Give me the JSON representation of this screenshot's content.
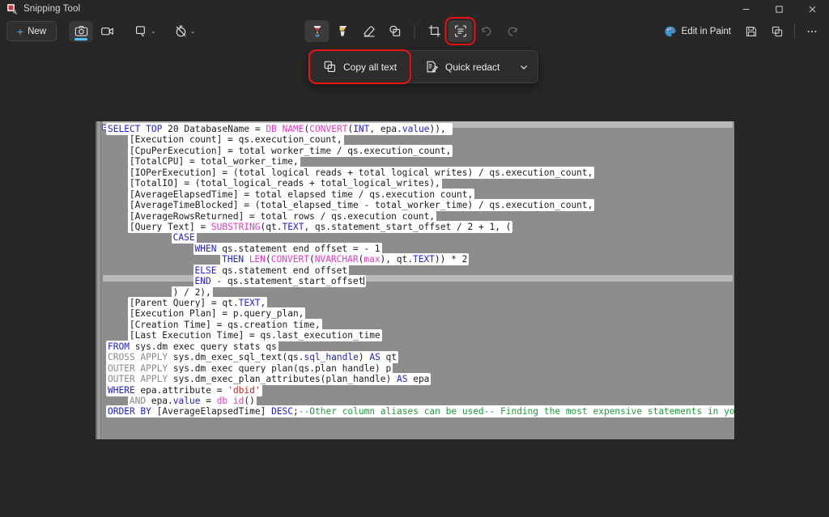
{
  "window": {
    "title": "Snipping Tool",
    "app_icon": "snipping-tool-icon",
    "controls": {
      "minimize": "—",
      "maximize": "□",
      "close": "✕"
    }
  },
  "toolbar": {
    "new_label": "New",
    "new_icon": "plus-icon",
    "mode_screenshot_icon": "camera-icon",
    "mode_video_icon": "video-camera-icon",
    "snip_mode_icon": "rectangle-snip-icon",
    "delay_icon": "timer-off-icon",
    "chevron": "⌄",
    "tools": [
      {
        "name": "ballpoint-pen",
        "label": "Ballpoint pen",
        "state": "selected",
        "color": "#e02b2b"
      },
      {
        "name": "highlighter",
        "label": "Highlighter",
        "state": "normal",
        "color": "#e8c723"
      },
      {
        "name": "eraser",
        "label": "Eraser",
        "state": "normal",
        "color": "#e2e2e2"
      },
      {
        "name": "shapes",
        "label": "Shapes",
        "state": "normal",
        "color": "#e2e2e2"
      },
      {
        "name": "crop",
        "label": "Crop",
        "state": "normal",
        "color": "#e2e2e2"
      },
      {
        "name": "text-actions",
        "label": "Text actions",
        "state": "highlighted",
        "color": "#e2e2e2"
      },
      {
        "name": "undo",
        "label": "Undo",
        "state": "disabled",
        "color": "#6d6d6d"
      },
      {
        "name": "redo",
        "label": "Redo",
        "state": "disabled",
        "color": "#6d6d6d"
      }
    ],
    "edit_in_paint_label": "Edit in Paint",
    "edit_in_paint_icon": "paint-palette-icon",
    "save_icon": "save-disk-icon",
    "copy_icon": "copy-icon",
    "more_icon": "ellipsis-icon"
  },
  "text_actions_flyout": {
    "copy_all_text": {
      "label": "Copy all text",
      "icon": "copy-text-icon",
      "highlighted": true
    },
    "quick_redact": {
      "label": "Quick redact",
      "icon": "redact-document-icon"
    },
    "chevron": "⌄",
    "highlight_color": "#ee1111"
  },
  "canvas": {
    "name": "snipped-image-sql-query",
    "background": "#8d8d8d",
    "caret_line_index": 14,
    "lines": [
      {
        "indent": 0,
        "segments": [
          {
            "c": "kw",
            "t": "SELECT"
          },
          {
            "c": "txt",
            "t": " "
          },
          {
            "c": "kw",
            "t": "TOP"
          },
          {
            "c": "txt",
            "t": " 20 DatabaseName = "
          },
          {
            "c": "fn",
            "t": "DB_NAME"
          },
          {
            "c": "txt",
            "t": "("
          },
          {
            "c": "fn",
            "t": "CONVERT"
          },
          {
            "c": "txt",
            "t": "("
          },
          {
            "c": "kw",
            "t": "INT"
          },
          {
            "c": "txt",
            "t": ", epa."
          },
          {
            "c": "kw",
            "t": "value"
          },
          {
            "c": "txt",
            "t": ")), "
          }
        ]
      },
      {
        "indent": 4,
        "segments": [
          {
            "c": "txt",
            "t": "[Execution count] = qs.execution_count,"
          }
        ]
      },
      {
        "indent": 4,
        "segments": [
          {
            "c": "txt",
            "t": "[CpuPerExecution] = total_worker_time / qs.execution_count,"
          }
        ]
      },
      {
        "indent": 4,
        "segments": [
          {
            "c": "txt",
            "t": "[TotalCPU] = total_worker_time,"
          }
        ]
      },
      {
        "indent": 4,
        "segments": [
          {
            "c": "txt",
            "t": "[IOPerExecution] = (total_logical_reads + total_logical_writes) / qs.execution_count,"
          }
        ]
      },
      {
        "indent": 4,
        "segments": [
          {
            "c": "txt",
            "t": "[TotalIO] = (total_logical_reads + total_logical_writes),"
          }
        ]
      },
      {
        "indent": 4,
        "segments": [
          {
            "c": "txt",
            "t": "[AverageElapsedTime] = total_elapsed_time / qs.execution_count,"
          }
        ]
      },
      {
        "indent": 4,
        "segments": [
          {
            "c": "txt",
            "t": "[AverageTimeBlocked] = (total_elapsed_time - total_worker_time) / qs.execution_count,"
          }
        ]
      },
      {
        "indent": 4,
        "segments": [
          {
            "c": "txt",
            "t": "[AverageRowsReturned] = total_rows / qs.execution_count,"
          }
        ]
      },
      {
        "indent": 4,
        "segments": [
          {
            "c": "txt",
            "t": "[Query Text] = "
          },
          {
            "c": "fn",
            "t": "SUBSTRING"
          },
          {
            "c": "txt",
            "t": "(qt."
          },
          {
            "c": "kw",
            "t": "TEXT"
          },
          {
            "c": "txt",
            "t": ", qs.statement_start_offset / 2 + 1, ("
          }
        ]
      },
      {
        "indent": 12,
        "segments": [
          {
            "c": "kw",
            "t": "CASE"
          }
        ]
      },
      {
        "indent": 16,
        "segments": [
          {
            "c": "kw",
            "t": "WHEN"
          },
          {
            "c": "txt",
            "t": " qs.statement_end_offset = - 1"
          }
        ]
      },
      {
        "indent": 21,
        "segments": [
          {
            "c": "kw",
            "t": "THEN"
          },
          {
            "c": "txt",
            "t": " "
          },
          {
            "c": "fn",
            "t": "LEN"
          },
          {
            "c": "txt",
            "t": "("
          },
          {
            "c": "fn",
            "t": "CONVERT"
          },
          {
            "c": "txt",
            "t": "("
          },
          {
            "c": "fn",
            "t": "NVARCHAR"
          },
          {
            "c": "txt",
            "t": "("
          },
          {
            "c": "fn",
            "t": "max"
          },
          {
            "c": "txt",
            "t": "), qt."
          },
          {
            "c": "kw",
            "t": "TEXT"
          },
          {
            "c": "txt",
            "t": ")) * 2"
          }
        ]
      },
      {
        "indent": 16,
        "segments": [
          {
            "c": "kw",
            "t": "ELSE"
          },
          {
            "c": "txt",
            "t": " qs.statement_end_offset"
          }
        ]
      },
      {
        "indent": 16,
        "segments": [
          {
            "c": "kw",
            "t": "END"
          },
          {
            "c": "txt",
            "t": " - qs.statement_start_offset"
          }
        ]
      },
      {
        "indent": 12,
        "segments": [
          {
            "c": "txt",
            "t": ") / 2),"
          }
        ]
      },
      {
        "indent": 4,
        "segments": [
          {
            "c": "txt",
            "t": "[Parent Query] = qt."
          },
          {
            "c": "kw",
            "t": "TEXT"
          },
          {
            "c": "txt",
            "t": ","
          }
        ]
      },
      {
        "indent": 4,
        "segments": [
          {
            "c": "txt",
            "t": "[Execution Plan] = p.query_plan,"
          }
        ]
      },
      {
        "indent": 4,
        "segments": [
          {
            "c": "txt",
            "t": "[Creation Time] = qs.creation_time,"
          }
        ]
      },
      {
        "indent": 4,
        "segments": [
          {
            "c": "txt",
            "t": "[Last Execution Time] = qs.last_execution_time"
          }
        ]
      },
      {
        "indent": 0,
        "segments": [
          {
            "c": "kw",
            "t": "FROM"
          },
          {
            "c": "txt",
            "t": " sys.dm_exec_query_stats qs"
          }
        ]
      },
      {
        "indent": 0,
        "segments": [
          {
            "c": "kw2",
            "t": "CROSS APPLY"
          },
          {
            "c": "txt",
            "t": " sys.dm_exec_sql_text(qs."
          },
          {
            "c": "kw",
            "t": "sql_handle"
          },
          {
            "c": "txt",
            "t": ") "
          },
          {
            "c": "kw",
            "t": "AS"
          },
          {
            "c": "txt",
            "t": " qt"
          }
        ]
      },
      {
        "indent": 0,
        "segments": [
          {
            "c": "kw2",
            "t": "OUTER APPLY"
          },
          {
            "c": "txt",
            "t": " sys.dm_exec_query_plan(qs.plan_handle) p"
          }
        ]
      },
      {
        "indent": 0,
        "segments": [
          {
            "c": "kw2",
            "t": "OUTER APPLY"
          },
          {
            "c": "txt",
            "t": " sys.dm_exec_plan_attributes(plan_handle) "
          },
          {
            "c": "kw",
            "t": "AS"
          },
          {
            "c": "txt",
            "t": " epa"
          }
        ]
      },
      {
        "indent": 0,
        "segments": [
          {
            "c": "kw",
            "t": "WHERE"
          },
          {
            "c": "txt",
            "t": " epa.attribute = "
          },
          {
            "c": "str",
            "t": "'dbid'"
          }
        ]
      },
      {
        "indent": 4,
        "segments": [
          {
            "c": "kw2",
            "t": "AND"
          },
          {
            "c": "txt",
            "t": " epa."
          },
          {
            "c": "kw",
            "t": "value"
          },
          {
            "c": "txt",
            "t": " = "
          },
          {
            "c": "fn",
            "t": "db_id"
          },
          {
            "c": "txt",
            "t": "()"
          }
        ]
      },
      {
        "indent": 0,
        "segments": [
          {
            "c": "kw",
            "t": "ORDER BY"
          },
          {
            "c": "txt",
            "t": " [AverageElapsedTime] "
          },
          {
            "c": "kw",
            "t": "DESC"
          },
          {
            "c": "txt",
            "t": ";"
          },
          {
            "c": "cmt",
            "t": "--Other column aliases can be used-- Finding the most expensive statements in your database"
          }
        ]
      }
    ]
  }
}
